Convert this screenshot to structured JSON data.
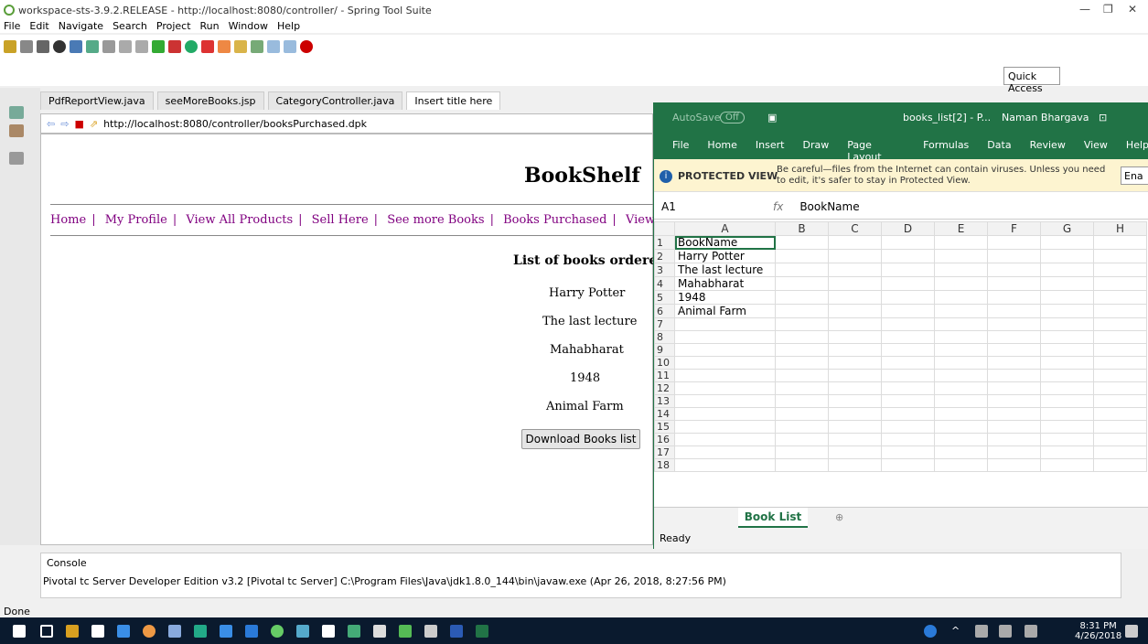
{
  "window": {
    "title": "workspace-sts-3.9.2.RELEASE - http://localhost:8080/controller/ - Spring Tool Suite"
  },
  "menu": [
    "File",
    "Edit",
    "Navigate",
    "Search",
    "Project",
    "Run",
    "Window",
    "Help"
  ],
  "quick_access": "Quick Access",
  "tabs": [
    "PdfReportView.java",
    "seeMoreBooks.jsp",
    "CategoryController.java",
    "Insert title here"
  ],
  "browser": {
    "url": "http://localhost:8080/controller/booksPurchased.dpk"
  },
  "page": {
    "brand": "BookShelf",
    "nav": [
      "Home",
      "My Profile",
      "View All Products",
      "Sell Here",
      "See more Books",
      "Books Purchased",
      "View Cart"
    ],
    "list_heading": "List of books ordered",
    "books": [
      "Harry Potter",
      "The last lecture",
      "Mahabharat",
      "1948",
      "Animal Farm"
    ],
    "download_label": "Download Books list"
  },
  "excel": {
    "autosave": "AutoSave",
    "autosave_state": "Off",
    "file": "books_list[2] - P...",
    "user": "Naman Bhargava",
    "ribbon": [
      "File",
      "Home",
      "Insert",
      "Draw",
      "Page Layout",
      "Formulas",
      "Data",
      "Review",
      "View",
      "Help"
    ],
    "protected_label": "PROTECTED VIEW",
    "protected_msg": "Be careful—files from the Internet can contain viruses. Unless you need to edit, it's safer to stay in Protected View.",
    "enable_btn": "Ena",
    "namebox": "A1",
    "formula": "BookName",
    "columns": [
      "A",
      "B",
      "C",
      "D",
      "E",
      "F",
      "G",
      "H"
    ],
    "cells": [
      "BookName",
      "Harry Potter",
      "The last lecture",
      "Mahabharat",
      "1948",
      "Animal Farm",
      "",
      "",
      "",
      "",
      "",
      "",
      "",
      "",
      "",
      "",
      "",
      ""
    ],
    "rows": [
      "1",
      "2",
      "3",
      "4",
      "5",
      "6",
      "7",
      "8",
      "9",
      "10",
      "11",
      "12",
      "13",
      "14",
      "15",
      "16",
      "17",
      "18"
    ],
    "sheet_tab": "Book List",
    "status": "Ready"
  },
  "console": {
    "title": "Console",
    "line": "Pivotal tc Server Developer Edition v3.2 [Pivotal tc Server] C:\\Program Files\\Java\\jdk1.8.0_144\\bin\\javaw.exe (Apr 26, 2018, 8:27:56 PM)"
  },
  "status_bar": "Done",
  "clock": {
    "time": "8:31 PM",
    "date": "4/26/2018"
  }
}
